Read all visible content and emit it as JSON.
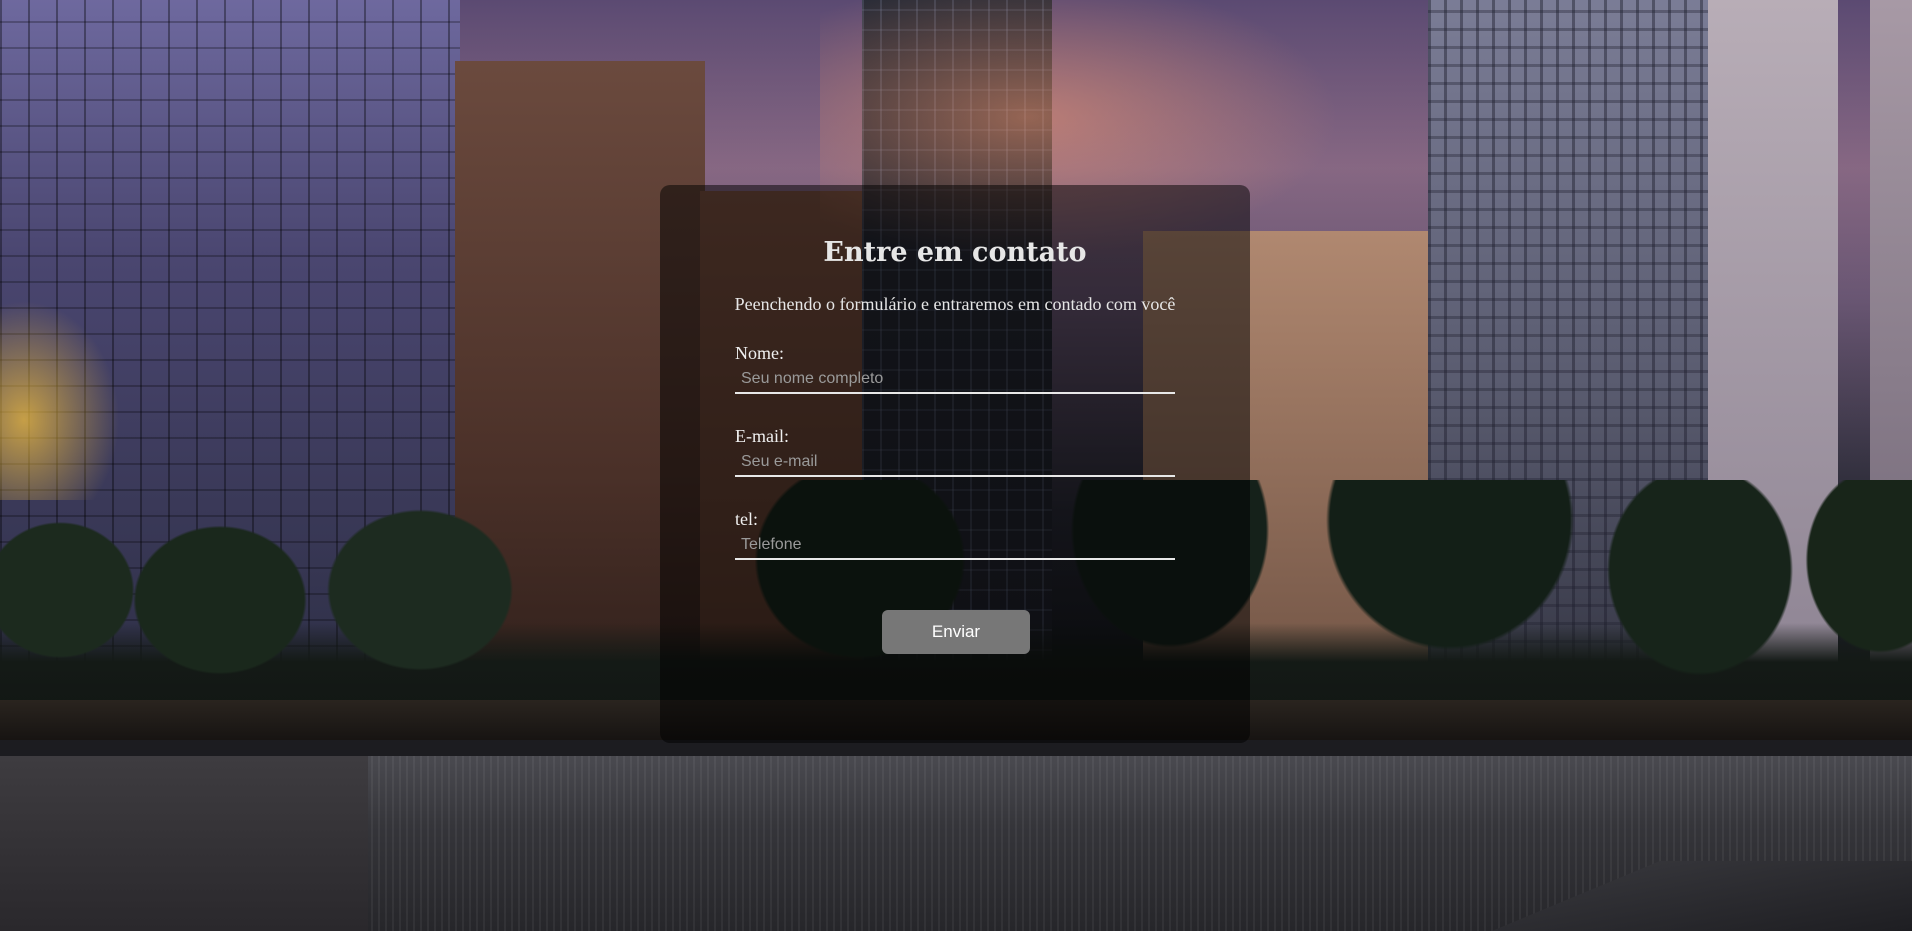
{
  "form": {
    "title": "Entre em contato",
    "subtitle": "Peenchendo o formulário e entraremos em contado com você",
    "fields": [
      {
        "label": "Nome:",
        "placeholder": "Seu nome completo",
        "value": ""
      },
      {
        "label": "E-mail:",
        "placeholder": "Seu e-mail",
        "value": ""
      },
      {
        "label": "tel:",
        "placeholder": "Telefone",
        "value": ""
      }
    ],
    "submit_label": "Enviar"
  },
  "colors": {
    "card_overlay": "#000000",
    "text": "#e6e6e6",
    "button": "#777777",
    "input_underline": "#e8e8e8"
  }
}
